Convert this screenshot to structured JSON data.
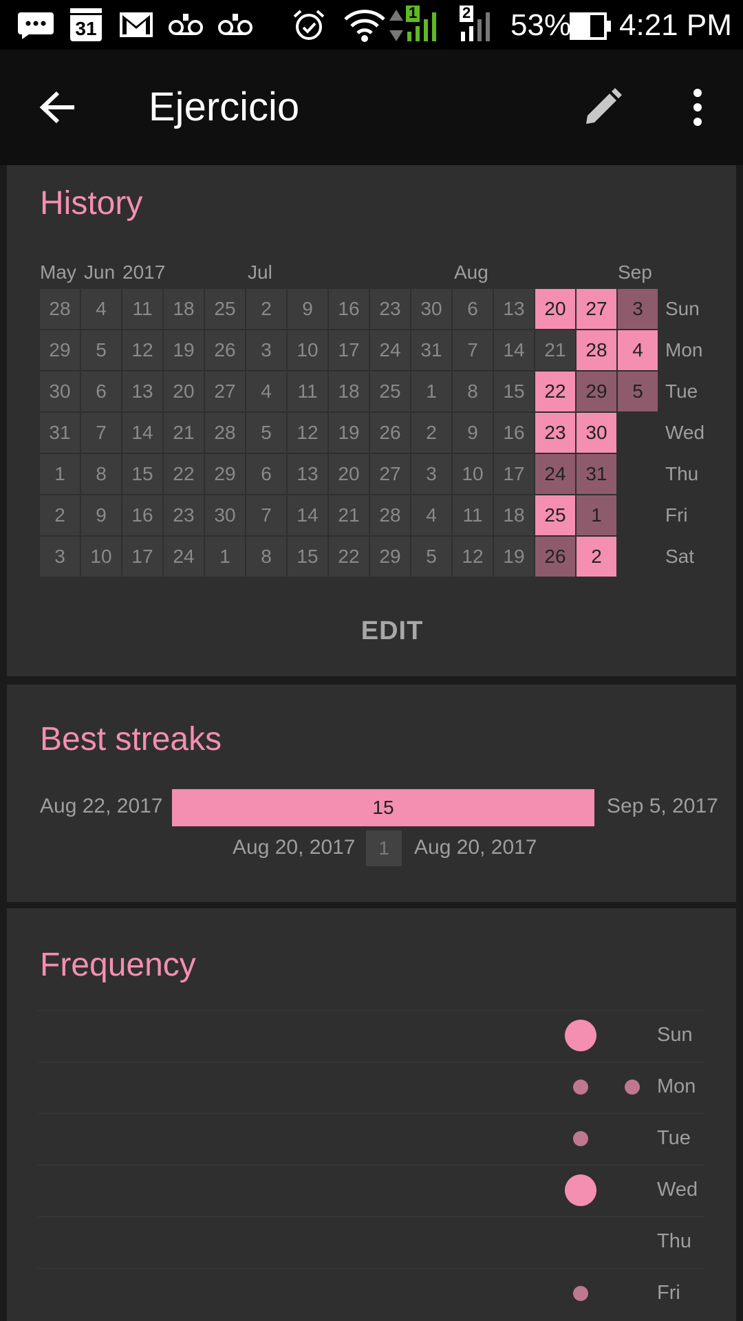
{
  "status_bar": {
    "calendar_day": "31",
    "battery_pct": "53%",
    "time": "4:21 PM",
    "sim1": "1",
    "sim2": "2"
  },
  "app_bar": {
    "title": "Ejercicio",
    "icons": [
      "back-arrow-icon",
      "edit-pencil-icon",
      "more-vert-icon"
    ]
  },
  "history": {
    "title": "History",
    "month_labels": [
      "May",
      "Jun",
      "2017",
      "Jul",
      "Aug",
      "Sep"
    ],
    "weekday_labels": [
      "Sun",
      "Mon",
      "Tue",
      "Wed",
      "Thu",
      "Fri",
      "Sat"
    ],
    "weeks": [
      [
        "28",
        "29",
        "30",
        "31",
        "1",
        "2",
        "3"
      ],
      [
        "4",
        "5",
        "6",
        "7",
        "8",
        "9",
        "10"
      ],
      [
        "11",
        "12",
        "13",
        "14",
        "15",
        "16",
        "17"
      ],
      [
        "18",
        "19",
        "20",
        "21",
        "22",
        "23",
        "24"
      ],
      [
        "25",
        "26",
        "27",
        "28",
        "29",
        "30",
        "1"
      ],
      [
        "2",
        "3",
        "4",
        "5",
        "6",
        "7",
        "8"
      ],
      [
        "9",
        "10",
        "11",
        "12",
        "13",
        "14",
        "15"
      ],
      [
        "16",
        "17",
        "18",
        "19",
        "20",
        "21",
        "22"
      ],
      [
        "23",
        "24",
        "25",
        "26",
        "27",
        "28",
        "29"
      ],
      [
        "30",
        "31",
        "1",
        "2",
        "3",
        "4",
        "5"
      ],
      [
        "6",
        "7",
        "8",
        "9",
        "10",
        "11",
        "12"
      ],
      [
        "13",
        "14",
        "15",
        "16",
        "17",
        "18",
        "19"
      ],
      [
        "20",
        "21",
        "22",
        "23",
        "24",
        "25",
        "26"
      ],
      [
        "27",
        "28",
        "29",
        "30",
        "31",
        "1",
        "2"
      ],
      [
        "3",
        "4",
        "5",
        "",
        "",
        "",
        ""
      ]
    ],
    "states": [
      [
        "n",
        "n",
        "n",
        "n",
        "n",
        "n",
        "n"
      ],
      [
        "n",
        "n",
        "n",
        "n",
        "n",
        "n",
        "n"
      ],
      [
        "n",
        "n",
        "n",
        "n",
        "n",
        "n",
        "n"
      ],
      [
        "n",
        "n",
        "n",
        "n",
        "n",
        "n",
        "n"
      ],
      [
        "n",
        "n",
        "n",
        "n",
        "n",
        "n",
        "n"
      ],
      [
        "n",
        "n",
        "n",
        "n",
        "n",
        "n",
        "n"
      ],
      [
        "n",
        "n",
        "n",
        "n",
        "n",
        "n",
        "n"
      ],
      [
        "n",
        "n",
        "n",
        "n",
        "n",
        "n",
        "n"
      ],
      [
        "n",
        "n",
        "n",
        "n",
        "n",
        "n",
        "n"
      ],
      [
        "n",
        "n",
        "n",
        "n",
        "n",
        "n",
        "n"
      ],
      [
        "n",
        "n",
        "n",
        "n",
        "n",
        "n",
        "n"
      ],
      [
        "n",
        "n",
        "n",
        "n",
        "n",
        "n",
        "n"
      ],
      [
        "d",
        "n",
        "d",
        "d",
        "p",
        "d",
        "p"
      ],
      [
        "d",
        "d",
        "p",
        "d",
        "p",
        "p",
        "d"
      ],
      [
        "p",
        "d",
        "p",
        "",
        "",
        "",
        ""
      ]
    ],
    "edit_label": "EDIT",
    "colors": {
      "done": "#f48fb1",
      "partial": "#8e5b6d",
      "empty": "#3c3c3c"
    }
  },
  "best_streaks": {
    "title": "Best streaks",
    "streaks": [
      {
        "start": "Aug 22, 2017",
        "end": "Sep 5, 2017",
        "length": "15"
      },
      {
        "start": "Aug 20, 2017",
        "end": "Aug 20, 2017",
        "length": "1"
      }
    ]
  },
  "frequency": {
    "title": "Frequency",
    "weekday_labels": [
      "Sun",
      "Mon",
      "Tue",
      "Wed",
      "Thu",
      "Fri"
    ],
    "rows": [
      [
        0,
        1,
        0
      ],
      [
        0,
        0.4,
        0.4
      ],
      [
        0,
        0.4,
        0
      ],
      [
        0,
        1,
        0
      ],
      [
        0,
        0,
        0
      ],
      [
        0,
        0.4,
        0
      ]
    ]
  }
}
